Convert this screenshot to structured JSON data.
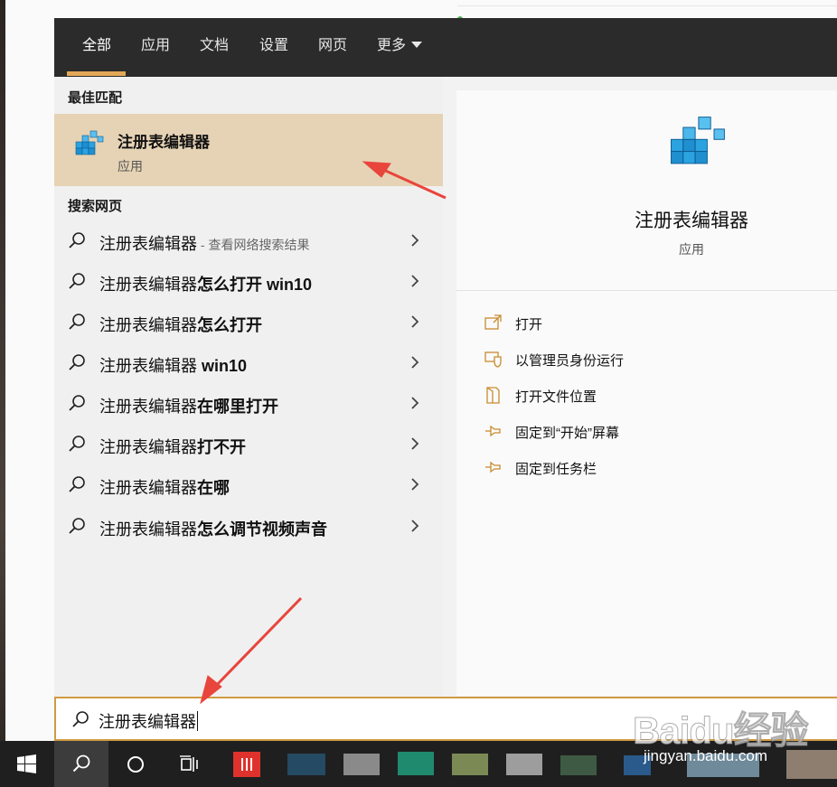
{
  "tabs": [
    {
      "label": "全部",
      "active": true
    },
    {
      "label": "应用"
    },
    {
      "label": "文档"
    },
    {
      "label": "设置"
    },
    {
      "label": "网页"
    },
    {
      "label": "更多"
    }
  ],
  "best_match": {
    "heading": "最佳匹配",
    "title": "注册表编辑器",
    "subtitle": "应用"
  },
  "web": {
    "heading": "搜索网页",
    "results": [
      {
        "prefix": "注册表编辑器",
        "bold": "",
        "hint": " - 查看网络搜索结果"
      },
      {
        "prefix": "注册表编辑器",
        "bold": "怎么打开 win10",
        "hint": ""
      },
      {
        "prefix": "注册表编辑器",
        "bold": "怎么打开",
        "hint": ""
      },
      {
        "prefix": "注册表编辑器",
        "bold": " win10",
        "hint": ""
      },
      {
        "prefix": "注册表编辑器",
        "bold": "在哪里打开",
        "hint": ""
      },
      {
        "prefix": "注册表编辑器",
        "bold": "打不开",
        "hint": ""
      },
      {
        "prefix": "注册表编辑器",
        "bold": "在哪",
        "hint": ""
      },
      {
        "prefix": "注册表编辑器",
        "bold": "怎么调节视频声音",
        "hint": ""
      }
    ]
  },
  "detail": {
    "title": "注册表编辑器",
    "subtitle": "应用",
    "actions": [
      {
        "label": "打开",
        "icon": "open-icon"
      },
      {
        "label": "以管理员身份运行",
        "icon": "shield-icon"
      },
      {
        "label": "打开文件位置",
        "icon": "file-location-icon"
      },
      {
        "label": "固定到“开始”屏幕",
        "icon": "pin-icon"
      },
      {
        "label": "固定到任务栏",
        "icon": "pin-icon"
      }
    ]
  },
  "search": {
    "value": "注册表编辑器"
  },
  "watermark": {
    "logo": "Baidu经验",
    "url": "jingyan.baidu.com"
  },
  "colors": {
    "accent": "#e3a857",
    "selection": "#e6d3b5",
    "annotation_arrow": "#e8453c",
    "topbar": "#2b2b2b"
  }
}
